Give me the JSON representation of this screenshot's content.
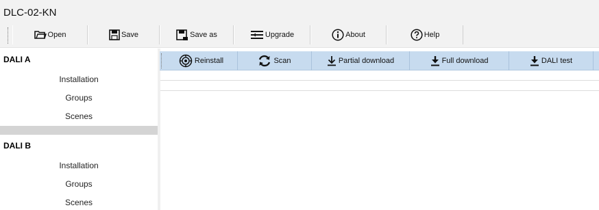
{
  "window": {
    "title": "DLC-02-KN"
  },
  "toolbar": {
    "open_label": "Open",
    "save_label": "Save",
    "saveas_label": "Save as",
    "upgrade_label": "Upgrade",
    "about_label": "About",
    "help_label": "Help"
  },
  "actionbar": {
    "reinstall_label": "Reinstall",
    "scan_label": "Scan",
    "partial_label": "Partial download",
    "full_label": "Full download",
    "dalitest_label": "DALI test"
  },
  "sidebar": {
    "groups": [
      {
        "header": "DALI A",
        "items": [
          "Installation",
          "Groups",
          "Scenes"
        ]
      },
      {
        "header": "DALI B",
        "items": [
          "Installation",
          "Groups",
          "Scenes"
        ]
      }
    ]
  },
  "colors": {
    "actionbar_bg": "#c7dbef",
    "toolbar_bg": "#f2f2f2",
    "separator": "#d4d4d4"
  }
}
